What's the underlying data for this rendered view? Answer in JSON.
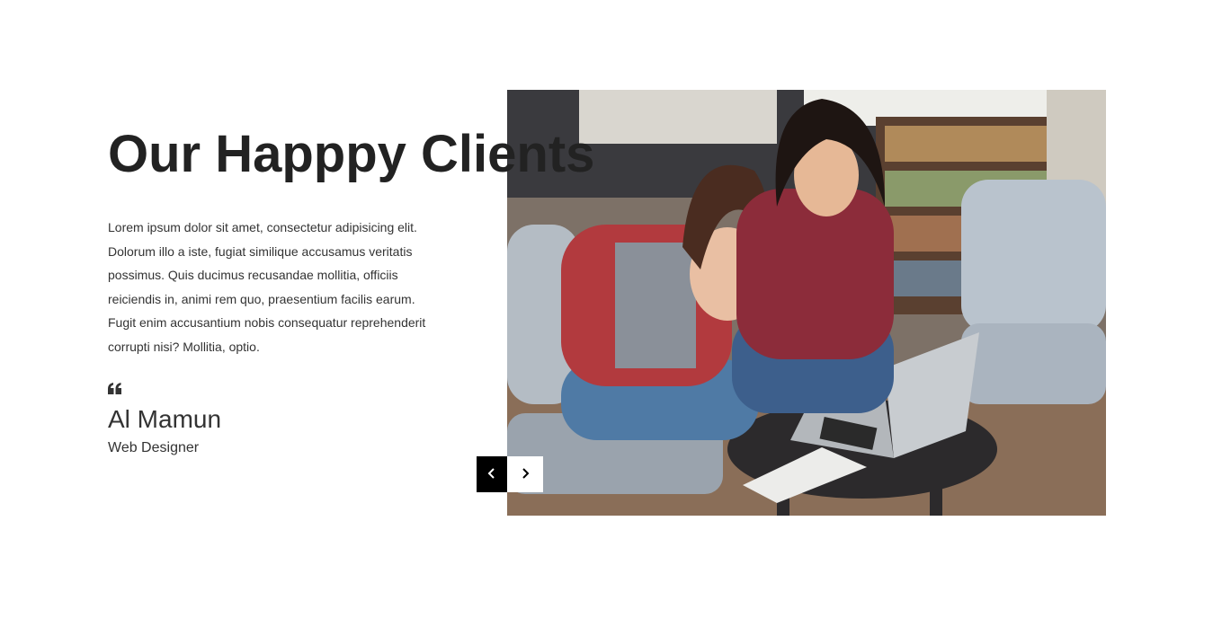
{
  "section": {
    "title": "Our Happpy Clients",
    "description": "Lorem ipsum dolor sit amet, consectetur adipisicing elit. Dolorum illo a iste, fugiat similique accusamus veritatis possimus. Quis ducimus recusandae mollitia, officiis reiciendis in, animi rem quo, praesentium facilis earum. Fugit enim accusantium nobis consequatur reprehenderit corrupti nisi? Mollitia, optio.",
    "quote_icon": "quote-left-icon",
    "client": {
      "name": "Al Mamun",
      "role": "Web Designer"
    }
  },
  "slider": {
    "prev_icon": "chevron-left-icon",
    "next_icon": "chevron-right-icon"
  },
  "colors": {
    "heading": "#222222",
    "text": "#333333",
    "prev_button_bg": "#000000",
    "next_button_bg": "#ffffff"
  }
}
